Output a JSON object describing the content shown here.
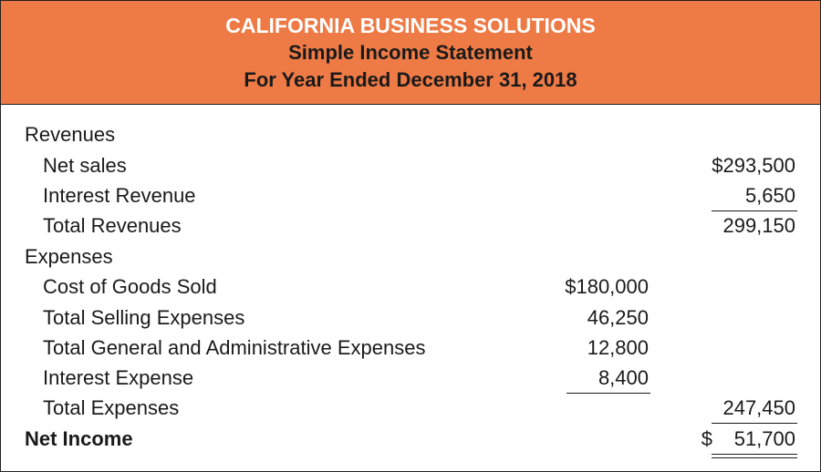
{
  "header": {
    "company": "CALIFORNIA BUSINESS SOLUTIONS",
    "statement_name": "Simple Income Statement",
    "period": "For Year Ended December 31, 2018"
  },
  "colors": {
    "header_bg": "#ee7a45",
    "header_company_text": "#ffffff",
    "text": "#1a1a1a"
  },
  "revenues": {
    "heading": "Revenues",
    "net_sales_label": "Net sales",
    "net_sales_amount": "$293,500",
    "interest_revenue_label": "Interest Revenue",
    "interest_revenue_amount": "5,650",
    "total_revenues_label": "Total Revenues",
    "total_revenues_amount": "299,150"
  },
  "expenses": {
    "heading": "Expenses",
    "cogs_label": "Cost of Goods Sold",
    "cogs_amount": "$180,000",
    "selling_label": "Total Selling Expenses",
    "selling_amount": "46,250",
    "general_admin_label": "Total General and Administrative Expenses",
    "general_admin_amount": "12,800",
    "interest_expense_label": "Interest Expense",
    "interest_expense_amount": "8,400",
    "total_expenses_label": "Total Expenses",
    "total_expenses_amount": "247,450"
  },
  "net_income": {
    "label": "Net Income",
    "currency": "$",
    "amount": "51,700"
  }
}
